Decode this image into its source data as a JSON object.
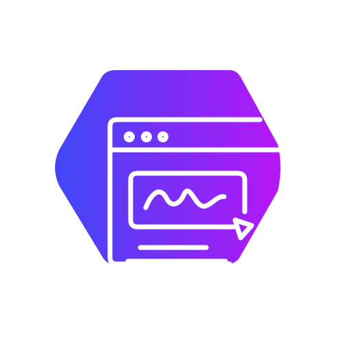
{
  "icon": {
    "name": "web-signature-icon",
    "gradient": {
      "start": "#3F47F7",
      "end": "#B516F5"
    },
    "foreground": "#FFFFFF",
    "background": "#FFFFFF"
  }
}
